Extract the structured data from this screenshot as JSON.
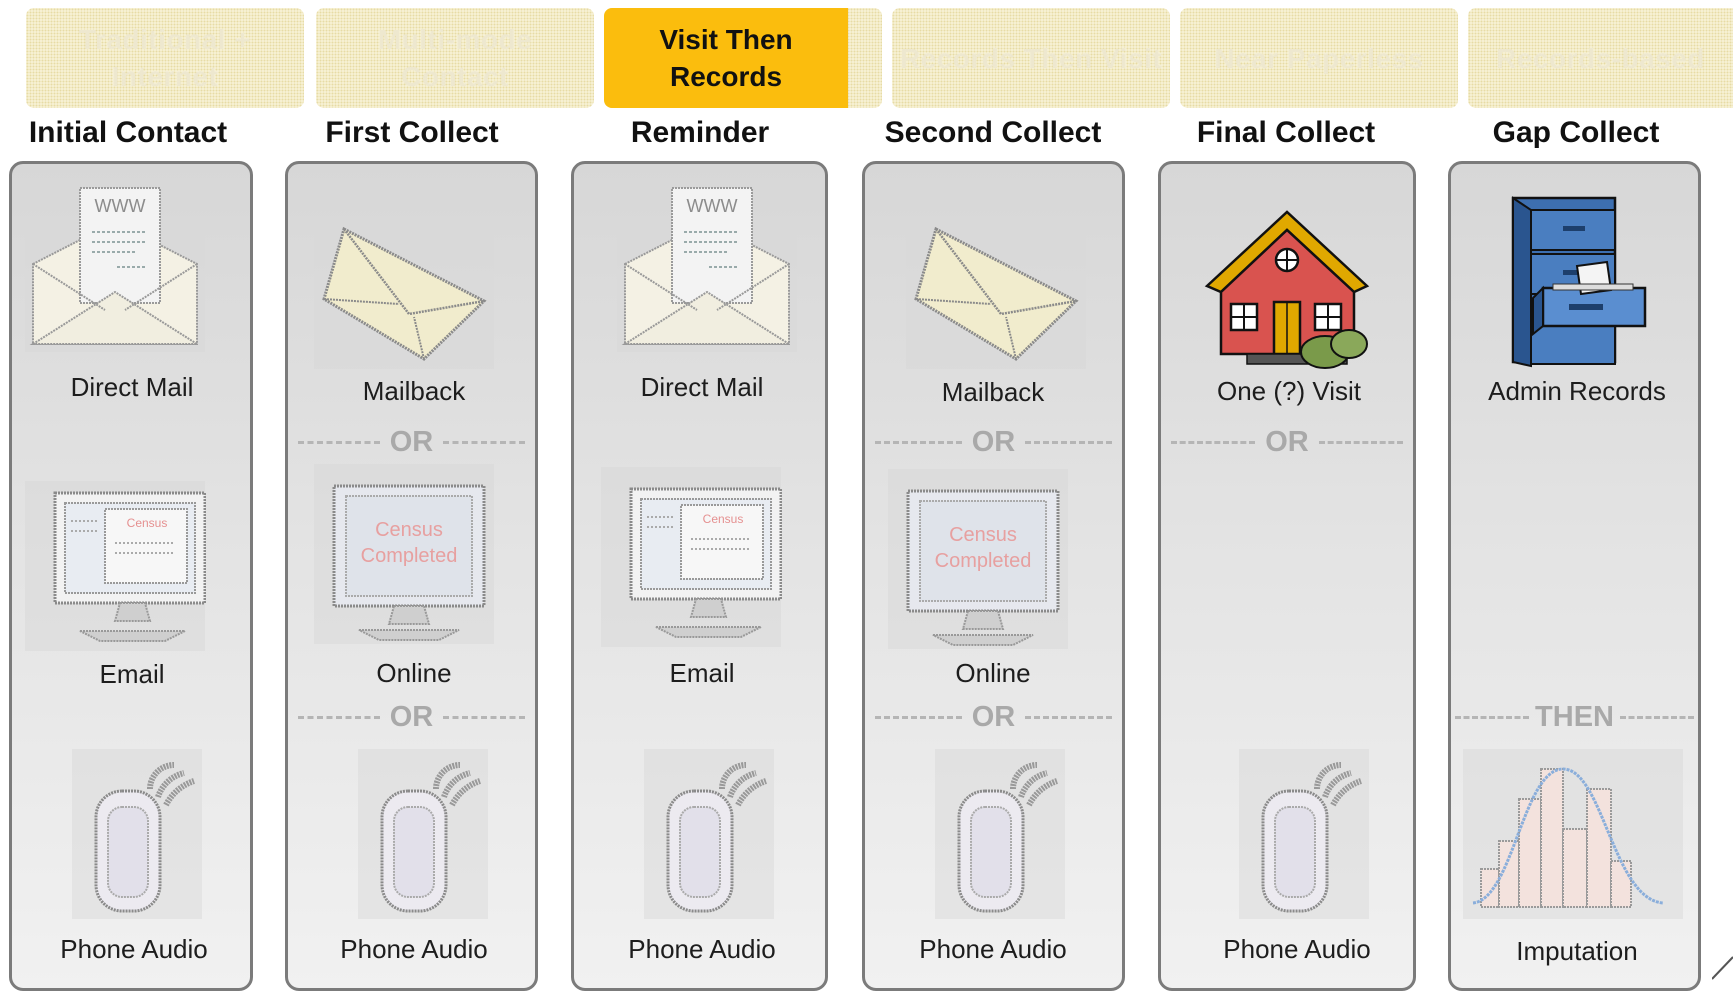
{
  "tabs": [
    {
      "label": "Traditional + Internet",
      "active": false
    },
    {
      "label": "Multi-mode Contact",
      "active": false
    },
    {
      "label": "Visit Then Records",
      "active": true
    },
    {
      "label": "Records Then Visit",
      "active": false
    },
    {
      "label": "Near Paperless",
      "active": false
    },
    {
      "label": "Records-based",
      "active": false
    }
  ],
  "columns": [
    {
      "header": "Initial Contact",
      "items": [
        "Direct Mail",
        "Email",
        "Phone Audio"
      ],
      "separators": []
    },
    {
      "header": "First Collect",
      "items": [
        "Mailback",
        "Online",
        "Phone Audio"
      ],
      "separators": [
        "OR",
        "OR"
      ]
    },
    {
      "header": "Reminder",
      "items": [
        "Direct Mail",
        "Email",
        "Phone Audio"
      ],
      "separators": []
    },
    {
      "header": "Second Collect",
      "items": [
        "Mailback",
        "Online",
        "Phone Audio"
      ],
      "separators": [
        "OR",
        "OR"
      ]
    },
    {
      "header": "Final Collect",
      "items": [
        "One (?) Visit",
        "Phone Audio"
      ],
      "separators": [
        "OR"
      ]
    },
    {
      "header": "Gap Collect",
      "items": [
        "Admin Records",
        "Imputation"
      ],
      "separators": [
        "THEN"
      ]
    }
  ],
  "screen_text": {
    "email_screen": "Census",
    "online_screen_line1": "Census",
    "online_screen_line2": "Completed",
    "letter_header": "WWW"
  },
  "icons": {
    "direct_mail": "envelope-letter-icon",
    "mailback": "envelope-icon",
    "email": "monitor-email-icon",
    "online": "monitor-census-icon",
    "phone": "mobile-phone-icon",
    "visit": "house-icon",
    "records": "filing-cabinet-icon",
    "imputation": "histogram-icon"
  },
  "colors": {
    "active_tab": "#fbbd0d",
    "inactive_tab": "#faf5dc",
    "column_border": "#7b7b7b",
    "separator": "#a9a9a9",
    "house_wall": "#d9534f",
    "house_roof": "#e0a800",
    "cabinet": "#3d6fb0"
  }
}
